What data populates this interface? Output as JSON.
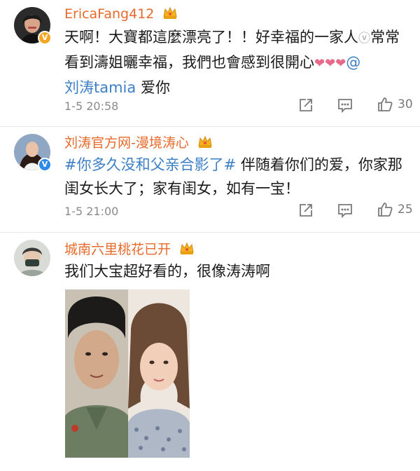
{
  "comments": [
    {
      "username": "EricaFang412",
      "badge_icon": "crown-icon",
      "text_parts": [
        "天啊！大寶都這麼漂亮了！！好幸福的一家人",
        "常常看到濤姐曬幸福，我們也會感到很開心",
        "@"
      ],
      "mention": "刘涛tamia",
      "text_tail": " 爱你",
      "time": "1-5 20:58",
      "like_count": "30"
    },
    {
      "username": "刘涛官方网-漫境涛心",
      "badge_icon": "crown-icon",
      "hashtag": "#你多久没和父亲合影了#",
      "text": " 伴随着你们的爱，你家那闺女长大了；家有闺女，如有一宝！",
      "time": "1-5 21:00",
      "like_count": "25"
    },
    {
      "username": "城南六里桃花已开",
      "badge_icon": "crown-icon",
      "text": "我们大宝超好看的，很像涛涛啊"
    }
  ],
  "colors": {
    "username": "#e86a2a",
    "link": "#3d7fc6",
    "meta": "#8a8a8a",
    "divider": "#e6e6e6"
  }
}
